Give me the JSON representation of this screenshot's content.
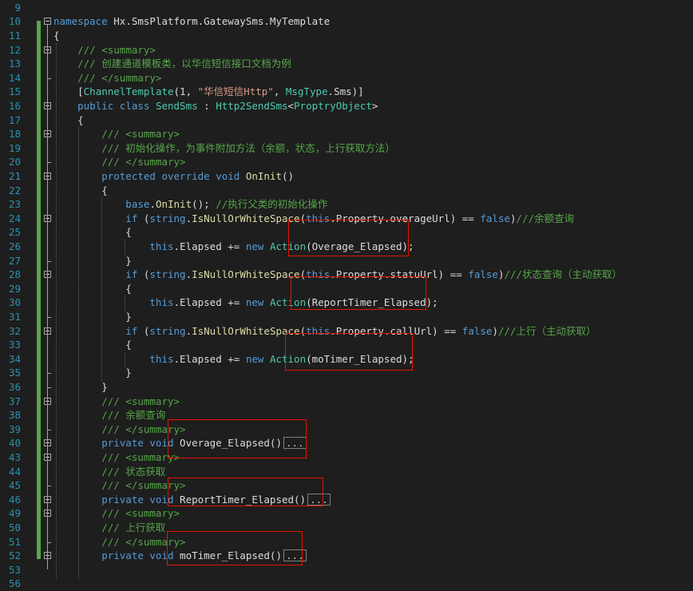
{
  "editor": {
    "line_numbers": [
      "9",
      "10",
      "11",
      "12",
      "13",
      "14",
      "15",
      "16",
      "17",
      "18",
      "19",
      "20",
      "21",
      "22",
      "23",
      "24",
      "25",
      "26",
      "27",
      "28",
      "29",
      "30",
      "31",
      "32",
      "33",
      "34",
      "35",
      "36",
      "37",
      "38",
      "39",
      "40",
      "43",
      "44",
      "45",
      "46",
      "49",
      "50",
      "51",
      "52",
      "53",
      "56"
    ],
    "lines": [
      {
        "ln": "10",
        "tokens": [
          {
            "t": "namespace ",
            "c": "k"
          },
          {
            "t": "Hx.SmsPlatform.GatewaySms.MyTemplate",
            "c": "d"
          }
        ]
      },
      {
        "ln": "11",
        "tokens": [
          {
            "t": "{",
            "c": "d"
          }
        ]
      },
      {
        "ln": "12",
        "tokens": [
          {
            "t": "    /// ",
            "c": "c"
          },
          {
            "t": "<summary>",
            "c": "c"
          }
        ]
      },
      {
        "ln": "13",
        "tokens": [
          {
            "t": "    /// 创建通道模板类，以华信短信接口文档为例",
            "c": "c"
          }
        ]
      },
      {
        "ln": "14",
        "tokens": [
          {
            "t": "    /// </summary>",
            "c": "c"
          }
        ]
      },
      {
        "ln": "15",
        "tokens": [
          {
            "t": "    [",
            "c": "d"
          },
          {
            "t": "ChannelTemplate",
            "c": "t"
          },
          {
            "t": "(1, ",
            "c": "d"
          },
          {
            "t": "\"华信短信Http\"",
            "c": "s"
          },
          {
            "t": ", ",
            "c": "d"
          },
          {
            "t": "MsgType",
            "c": "t"
          },
          {
            "t": ".Sms)]",
            "c": "d"
          }
        ]
      },
      {
        "ln": "16",
        "tokens": [
          {
            "t": "    public class ",
            "c": "k"
          },
          {
            "t": "SendSms",
            "c": "t"
          },
          {
            "t": " : ",
            "c": "d"
          },
          {
            "t": "Http2SendSms",
            "c": "t"
          },
          {
            "t": "<",
            "c": "d"
          },
          {
            "t": "ProptryObject",
            "c": "t"
          },
          {
            "t": ">",
            "c": "d"
          }
        ]
      },
      {
        "ln": "17",
        "tokens": [
          {
            "t": "    {",
            "c": "d"
          }
        ]
      },
      {
        "ln": "18",
        "tokens": [
          {
            "t": "        /// <summary>",
            "c": "c"
          }
        ]
      },
      {
        "ln": "19",
        "tokens": [
          {
            "t": "        /// 初始化操作，为事件附加方法（余额，状态，上行获取方法）",
            "c": "c"
          }
        ]
      },
      {
        "ln": "20",
        "tokens": [
          {
            "t": "        /// </summary>",
            "c": "c"
          }
        ]
      },
      {
        "ln": "21",
        "tokens": [
          {
            "t": "        protected override void ",
            "c": "k"
          },
          {
            "t": "OnInit",
            "c": "m"
          },
          {
            "t": "()",
            "c": "d"
          }
        ]
      },
      {
        "ln": "22",
        "tokens": [
          {
            "t": "        {",
            "c": "d"
          }
        ]
      },
      {
        "ln": "23",
        "tokens": [
          {
            "t": "            base",
            "c": "k"
          },
          {
            "t": ".",
            "c": "d"
          },
          {
            "t": "OnInit",
            "c": "m"
          },
          {
            "t": "(); ",
            "c": "d"
          },
          {
            "t": "//执行父类的初始化操作",
            "c": "c"
          }
        ]
      },
      {
        "ln": "24",
        "tokens": [
          {
            "t": "            if ",
            "c": "k"
          },
          {
            "t": "(",
            "c": "d"
          },
          {
            "t": "string",
            "c": "k"
          },
          {
            "t": ".",
            "c": "d"
          },
          {
            "t": "IsNullOrWhiteSpace",
            "c": "m"
          },
          {
            "t": "(",
            "c": "d"
          },
          {
            "t": "this",
            "c": "k"
          },
          {
            "t": ".Property.overageUrl) == ",
            "c": "d"
          },
          {
            "t": "false",
            "c": "k"
          },
          {
            "t": ")",
            "c": "d"
          },
          {
            "t": "///余额查询",
            "c": "c"
          }
        ]
      },
      {
        "ln": "25",
        "tokens": [
          {
            "t": "            {",
            "c": "d"
          }
        ]
      },
      {
        "ln": "26",
        "tokens": [
          {
            "t": "                this",
            "c": "k"
          },
          {
            "t": ".Elapsed += ",
            "c": "d"
          },
          {
            "t": "new ",
            "c": "k"
          },
          {
            "t": "Action",
            "c": "t"
          },
          {
            "t": "(Overage_Elapsed);",
            "c": "d"
          }
        ]
      },
      {
        "ln": "27",
        "tokens": [
          {
            "t": "            }",
            "c": "d"
          }
        ]
      },
      {
        "ln": "28",
        "tokens": [
          {
            "t": "            if ",
            "c": "k"
          },
          {
            "t": "(",
            "c": "d"
          },
          {
            "t": "string",
            "c": "k"
          },
          {
            "t": ".",
            "c": "d"
          },
          {
            "t": "IsNullOrWhiteSpace",
            "c": "m"
          },
          {
            "t": "(",
            "c": "d"
          },
          {
            "t": "this",
            "c": "k"
          },
          {
            "t": ".Property.statuUrl) == ",
            "c": "d"
          },
          {
            "t": "false",
            "c": "k"
          },
          {
            "t": ")",
            "c": "d"
          },
          {
            "t": "///状态查询（主动获取）",
            "c": "c"
          }
        ]
      },
      {
        "ln": "29",
        "tokens": [
          {
            "t": "            {",
            "c": "d"
          }
        ]
      },
      {
        "ln": "30",
        "tokens": [
          {
            "t": "                this",
            "c": "k"
          },
          {
            "t": ".Elapsed += ",
            "c": "d"
          },
          {
            "t": "new ",
            "c": "k"
          },
          {
            "t": "Action",
            "c": "t"
          },
          {
            "t": "(ReportTimer_Elapsed);",
            "c": "d"
          }
        ]
      },
      {
        "ln": "31",
        "tokens": [
          {
            "t": "            }",
            "c": "d"
          }
        ]
      },
      {
        "ln": "32",
        "tokens": [
          {
            "t": "            if ",
            "c": "k"
          },
          {
            "t": "(",
            "c": "d"
          },
          {
            "t": "string",
            "c": "k"
          },
          {
            "t": ".",
            "c": "d"
          },
          {
            "t": "IsNullOrWhiteSpace",
            "c": "m"
          },
          {
            "t": "(",
            "c": "d"
          },
          {
            "t": "this",
            "c": "k"
          },
          {
            "t": ".Property.callUrl) == ",
            "c": "d"
          },
          {
            "t": "false",
            "c": "k"
          },
          {
            "t": ")",
            "c": "d"
          },
          {
            "t": "///上行（主动获取）",
            "c": "c"
          }
        ]
      },
      {
        "ln": "33",
        "tokens": [
          {
            "t": "            {",
            "c": "d"
          }
        ]
      },
      {
        "ln": "34",
        "tokens": [
          {
            "t": "                this",
            "c": "k"
          },
          {
            "t": ".Elapsed += ",
            "c": "d"
          },
          {
            "t": "new ",
            "c": "k"
          },
          {
            "t": "Action",
            "c": "t"
          },
          {
            "t": "(moTimer_Elapsed);",
            "c": "d"
          }
        ]
      },
      {
        "ln": "35",
        "tokens": [
          {
            "t": "            }",
            "c": "d"
          }
        ]
      },
      {
        "ln": "36",
        "tokens": [
          {
            "t": "        }",
            "c": "d"
          }
        ]
      },
      {
        "ln": "37",
        "tokens": [
          {
            "t": "        /// <summary>",
            "c": "c"
          }
        ]
      },
      {
        "ln": "38",
        "tokens": [
          {
            "t": "        /// 余额查询",
            "c": "c"
          }
        ]
      },
      {
        "ln": "39",
        "tokens": [
          {
            "t": "        /// </summary>",
            "c": "c"
          }
        ]
      },
      {
        "ln": "40",
        "tokens": [
          {
            "t": "        private void ",
            "c": "k"
          },
          {
            "t": "Overage_Elapsed()",
            "c": "d"
          }
        ],
        "collapsed": "..."
      },
      {
        "ln": "43",
        "tokens": [
          {
            "t": "        /// <summary>",
            "c": "c"
          }
        ]
      },
      {
        "ln": "44",
        "tokens": [
          {
            "t": "        /// 状态获取",
            "c": "c"
          }
        ]
      },
      {
        "ln": "45",
        "tokens": [
          {
            "t": "        /// </summary>",
            "c": "c"
          }
        ]
      },
      {
        "ln": "46",
        "tokens": [
          {
            "t": "        private void ",
            "c": "k"
          },
          {
            "t": "ReportTimer_Elapsed()",
            "c": "d"
          }
        ],
        "collapsed": "..."
      },
      {
        "ln": "49",
        "tokens": [
          {
            "t": "        /// <summary>",
            "c": "c"
          }
        ]
      },
      {
        "ln": "50",
        "tokens": [
          {
            "t": "        /// 上行获取",
            "c": "c"
          }
        ]
      },
      {
        "ln": "51",
        "tokens": [
          {
            "t": "        /// </summary>",
            "c": "c"
          }
        ]
      },
      {
        "ln": "52",
        "tokens": [
          {
            "t": "        private void ",
            "c": "k"
          },
          {
            "t": "moTimer_Elapsed()",
            "c": "d"
          }
        ],
        "collapsed": "..."
      },
      {
        "ln": "53",
        "tokens": [
          {
            "t": "",
            "c": "d"
          }
        ]
      }
    ]
  }
}
